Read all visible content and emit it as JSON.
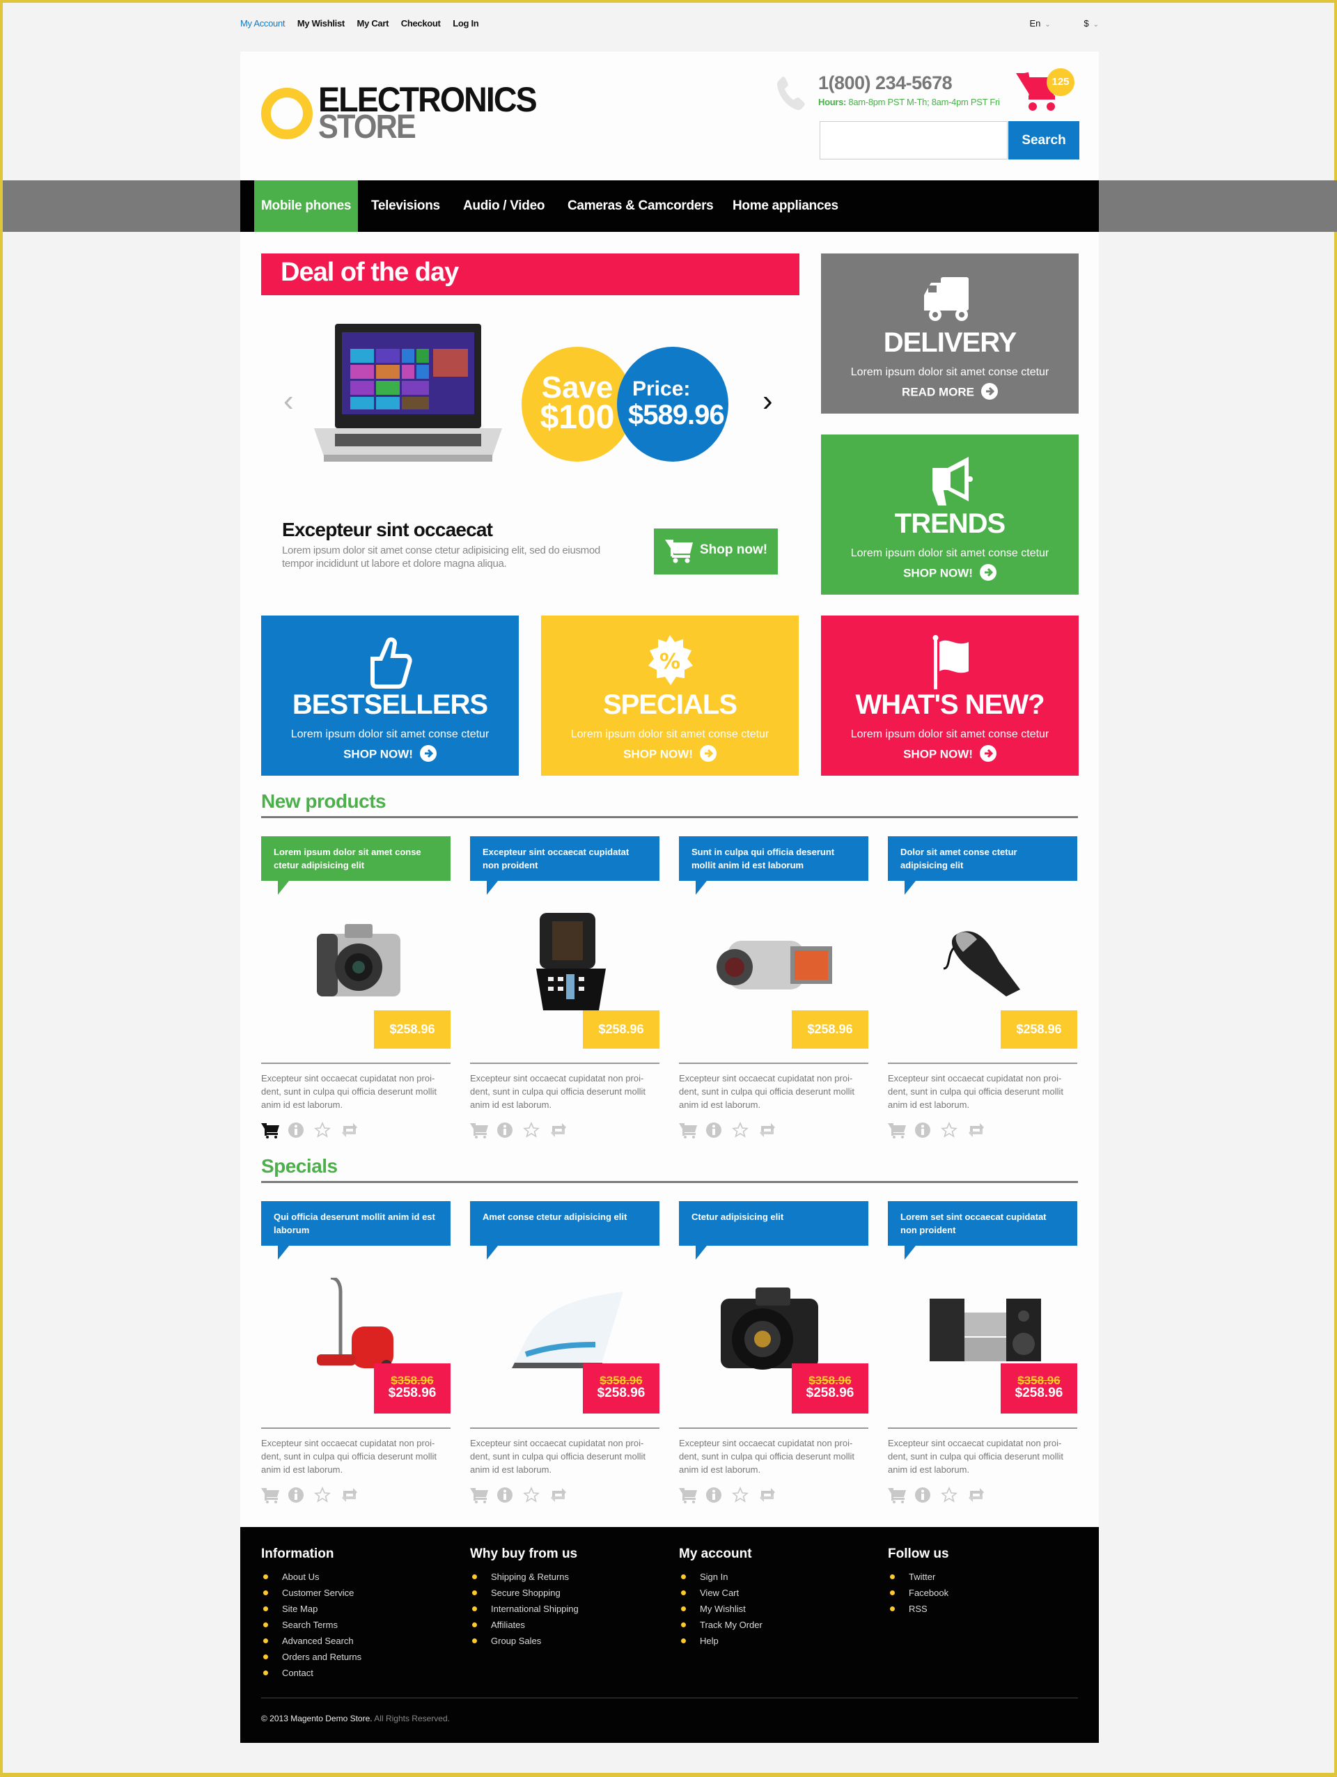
{
  "top_links": {
    "items": [
      "My Account",
      "My Wishlist",
      "My Cart",
      "Checkout",
      "Log In"
    ],
    "language": "En",
    "currency": "$"
  },
  "header": {
    "logo_line1": "ELECTRONICS",
    "logo_line2": "STORE",
    "phone": "1(800) 234-5678",
    "hours_label": "Hours:",
    "hours_value": "8am-8pm PST M-Th; 8am-4pm PST Fri",
    "cart_count": "125",
    "search_value": "",
    "search_placeholder": "",
    "search_button": "Search"
  },
  "nav": {
    "items": [
      "Mobile phones",
      "Televisions",
      "Audio / Video",
      "Cameras & Camcorders",
      "Home appliances"
    ],
    "active_index": 0
  },
  "deal": {
    "heading": "Deal of the day",
    "save_line1": "Save",
    "save_line2": "$100",
    "price_line1": "Price:",
    "price_line2": "$589.96",
    "title": "Excepteur sint occaecat",
    "description": "Lorem ipsum dolor sit amet conse ctetur adipisicing elit, sed do eiusmod tempor incididunt ut labore et dolore magna aliqua.",
    "shop_button": "Shop now!"
  },
  "tiles": [
    {
      "title": "DELIVERY",
      "subtitle": "Lorem ipsum dolor sit amet conse ctetur",
      "link": "READ MORE",
      "icon": "truck-icon",
      "color": "#7a7a7a"
    },
    {
      "title": "TRENDS",
      "subtitle": "Lorem ipsum dolor sit amet conse ctetur",
      "link": "SHOP NOW!",
      "icon": "megaphone-icon",
      "color": "#4bb04a"
    },
    {
      "title": "BESTSELLERS",
      "subtitle": "Lorem ipsum dolor sit amet conse ctetur",
      "link": "SHOP NOW!",
      "icon": "thumbs-up-icon",
      "color": "#0f7bc8"
    },
    {
      "title": "SPECIALS",
      "subtitle": "Lorem ipsum dolor sit amet conse ctetur",
      "link": "SHOP NOW!",
      "icon": "percent-badge-icon",
      "color": "#fcca2b"
    },
    {
      "title": "WHAT'S NEW?",
      "subtitle": "Lorem ipsum dolor sit amet conse ctetur",
      "link": "SHOP NOW!",
      "icon": "flag-icon",
      "color": "#f2194e"
    }
  ],
  "new_products": {
    "heading": "New products",
    "items": [
      {
        "name": "Lorem ipsum dolor sit amet conse ctetur adipisicing elit",
        "price": "$258.96",
        "image": "dslr-camera",
        "description": "Excepteur sint occaecat cupidatat non proi-dent, sunt in culpa qui officia deserunt mollit anim id est laborum."
      },
      {
        "name": "Excepteur sint occaecat cupidatat non proident",
        "price": "$258.96",
        "image": "flip-phone",
        "description": "Excepteur sint occaecat cupidatat non proi-dent, sunt in culpa qui officia deserunt mollit anim id est laborum."
      },
      {
        "name": "Sunt in culpa qui officia deserunt mollit anim id est laborum",
        "price": "$258.96",
        "image": "camcorder",
        "description": "Excepteur sint occaecat cupidatat non proi-dent, sunt in culpa qui officia deserunt mollit anim id est laborum."
      },
      {
        "name": "Dolor sit amet conse ctetur adipisicing elit",
        "price": "$258.96",
        "image": "handheld-vacuum",
        "description": "Excepteur sint occaecat cupidatat non proi-dent, sunt in culpa qui officia deserunt mollit anim id est laborum."
      }
    ]
  },
  "specials": {
    "heading": "Specials",
    "items": [
      {
        "name": "Qui officia deserunt mollit anim id est laborum",
        "old_price": "$358.96",
        "price": "$258.96",
        "image": "vacuum-cleaner",
        "description": "Excepteur sint occaecat cupidatat non proi-dent, sunt in culpa qui officia deserunt mollit anim id est laborum."
      },
      {
        "name": "Amet conse ctetur adipisicing elit",
        "old_price": "$358.96",
        "price": "$258.96",
        "image": "steam-iron",
        "description": "Excepteur sint occaecat cupidatat non proi-dent, sunt in culpa qui officia deserunt mollit anim id est laborum."
      },
      {
        "name": "Ctetur adipisicing elit",
        "old_price": "$358.96",
        "price": "$258.96",
        "image": "dslr-camera-black",
        "description": "Excepteur sint occaecat cupidatat non proi-dent, sunt in culpa qui officia deserunt mollit anim id est laborum."
      },
      {
        "name": "Lorem set sint occaecat cupidatat non proident",
        "old_price": "$358.96",
        "price": "$258.96",
        "image": "stereo-system",
        "description": "Excepteur sint occaecat cupidatat non proi-dent, sunt in culpa qui officia deserunt mollit anim id est laborum."
      }
    ]
  },
  "footer": {
    "columns": [
      {
        "title": "Information",
        "links": [
          "About Us",
          "Customer Service",
          "Site Map",
          "Search Terms",
          "Advanced Search",
          "Orders and Returns",
          "Contact"
        ]
      },
      {
        "title": "Why buy from us",
        "links": [
          "Shipping & Returns",
          "Secure Shopping",
          "International Shipping",
          "Affiliates",
          "Group Sales"
        ]
      },
      {
        "title": "My account",
        "links": [
          "Sign In",
          "View Cart",
          "My Wishlist",
          "Track My Order",
          "Help"
        ]
      },
      {
        "title": "Follow us",
        "links": [
          "Twitter",
          "Facebook",
          "RSS"
        ]
      }
    ],
    "copyright": "© 2013 Magento Demo Store.",
    "rights": "All Rights Reserved."
  },
  "colors": {
    "green": "#4bb04a",
    "blue": "#0f7bc8",
    "yellow": "#fcca2b",
    "pink": "#f2194e",
    "grey": "#7a7a7a"
  }
}
